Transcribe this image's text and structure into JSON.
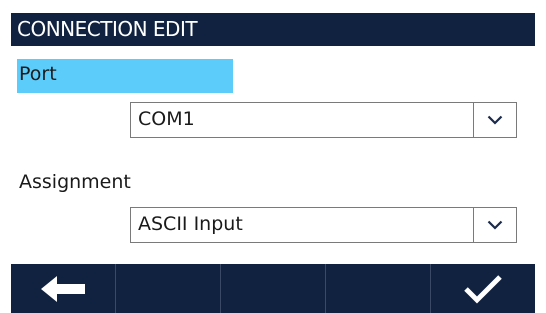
{
  "header": {
    "title": "CONNECTION EDIT"
  },
  "fields": {
    "port": {
      "label": "Port",
      "value": "COM1"
    },
    "assignment": {
      "label": "Assignment",
      "value": "ASCII Input"
    }
  },
  "softkeys": [
    {
      "icon": "left-arrow-icon"
    },
    {
      "icon": ""
    },
    {
      "icon": ""
    },
    {
      "icon": ""
    },
    {
      "icon": "checkmark-icon"
    }
  ],
  "colors": {
    "titlebar": "#102240",
    "selected_label": "#5cccfb",
    "softkey_bar": "#102240"
  }
}
